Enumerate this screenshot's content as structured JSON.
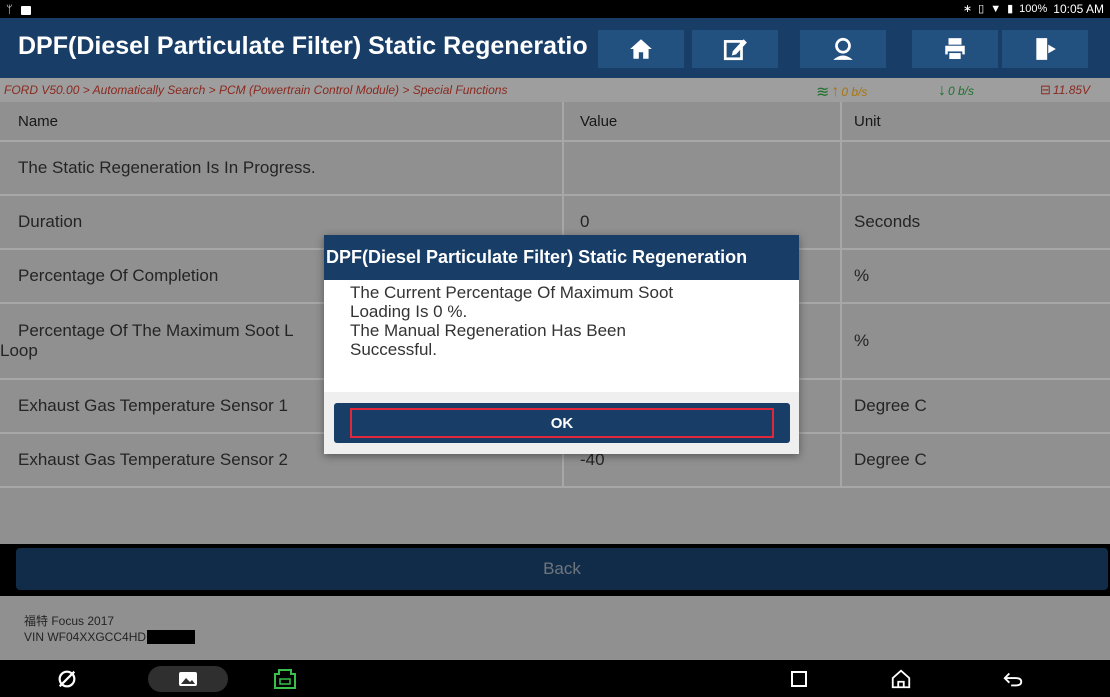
{
  "status_bar": {
    "left_icons": [
      "usb-icon",
      "image-icon"
    ],
    "right_icons": [
      "bluetooth-icon",
      "vibrate-icon",
      "wifi-icon",
      "battery-icon"
    ],
    "battery": "100%",
    "time": "10:05 AM"
  },
  "header": {
    "title": "DPF(Diesel Particulate Filter) Static Regeneration",
    "buttons": [
      "home-icon",
      "edit-icon",
      "user-icon",
      "print-icon",
      "exit-icon"
    ]
  },
  "breadcrumb": {
    "path": "FORD V50.00 > Automatically Search > PCM (Powertrain Control Module) > Special Functions",
    "upload": "0 b/s",
    "download": "0 b/s",
    "voltage": "11.85V"
  },
  "table": {
    "headers": {
      "name": "Name",
      "value": "Value",
      "unit": "Unit"
    },
    "rows": [
      {
        "name": "The Static Regeneration Is In Progress.",
        "value": "",
        "unit": ""
      },
      {
        "name": "Duration",
        "value": "0",
        "unit": "Seconds"
      },
      {
        "name": "Percentage Of Completion",
        "value": "",
        "unit": "%"
      },
      {
        "name": "Percentage Of The Maximum Soot L",
        "name2": "Loop",
        "value": "",
        "unit": "%"
      },
      {
        "name": "Exhaust Gas Temperature Sensor 1",
        "value": "",
        "unit": "Degree C"
      },
      {
        "name": "Exhaust Gas Temperature Sensor 2",
        "value": "-40",
        "unit": "Degree C"
      }
    ]
  },
  "back_label": "Back",
  "footer": {
    "vehicle": "福特 Focus 2017",
    "vin": "VIN WF04XXGCC4HD"
  },
  "dialog": {
    "title": "DPF(Diesel Particulate Filter) Static Regeneration",
    "message": "The Current Percentage Of Maximum Soot\nLoading Is 0 %.\nThe Manual Regeneration Has Been\nSuccessful.",
    "ok_label": "OK"
  },
  "colors": {
    "header_bg": "#183d66",
    "button_bg": "#22507f",
    "breadcrumb_text": "#c0392b",
    "upload_arrow": "#e8a317",
    "download_arrow": "#2e9d3f",
    "focus_border": "#e0283a"
  }
}
